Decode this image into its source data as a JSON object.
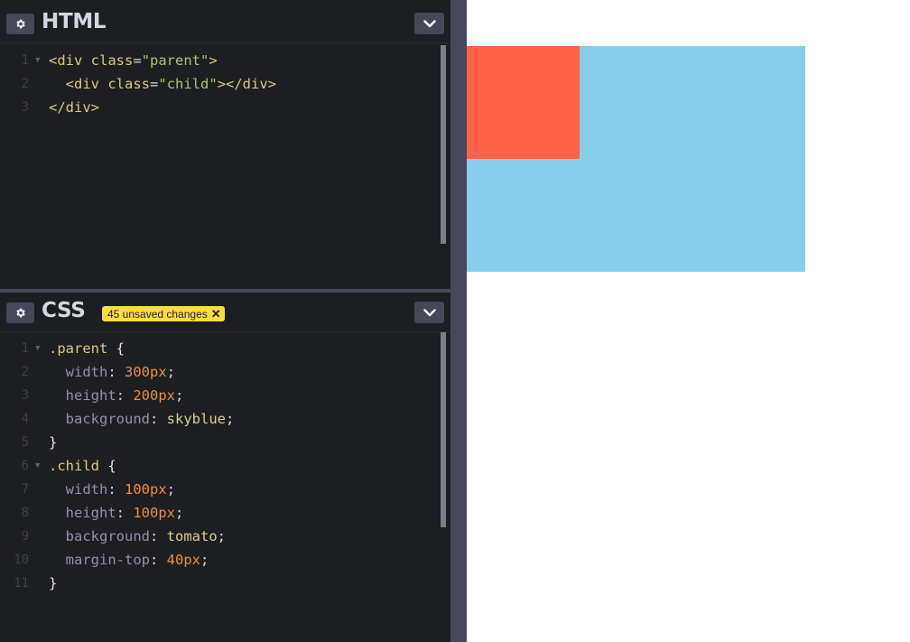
{
  "html_panel": {
    "title": "HTML",
    "lines": [
      {
        "n": "1",
        "fold": true,
        "tokens": [
          [
            "tag",
            "<div "
          ],
          [
            "attr",
            "class"
          ],
          [
            "punct",
            "="
          ],
          [
            "str",
            "\"parent\""
          ],
          [
            "tag",
            ">"
          ]
        ]
      },
      {
        "n": "2",
        "fold": false,
        "tokens": [
          [
            "plain",
            "  "
          ],
          [
            "tag",
            "<div "
          ],
          [
            "attr",
            "class"
          ],
          [
            "punct",
            "="
          ],
          [
            "str",
            "\"child\""
          ],
          [
            "tag",
            "></div>"
          ]
        ]
      },
      {
        "n": "3",
        "fold": false,
        "tokens": [
          [
            "tag",
            "</div>"
          ]
        ]
      }
    ]
  },
  "css_panel": {
    "title": "CSS",
    "badge": "45 unsaved changes",
    "lines": [
      {
        "n": "1",
        "fold": true,
        "tokens": [
          [
            "sel",
            ".parent"
          ],
          [
            "plain",
            " "
          ],
          [
            "brace",
            "{"
          ]
        ]
      },
      {
        "n": "2",
        "fold": false,
        "tokens": [
          [
            "plain",
            "  "
          ],
          [
            "prop",
            "width"
          ],
          [
            "punct",
            ": "
          ],
          [
            "num",
            "300px"
          ],
          [
            "punct",
            ";"
          ]
        ]
      },
      {
        "n": "3",
        "fold": false,
        "tokens": [
          [
            "plain",
            "  "
          ],
          [
            "prop",
            "height"
          ],
          [
            "punct",
            ": "
          ],
          [
            "num",
            "200px"
          ],
          [
            "punct",
            ";"
          ]
        ]
      },
      {
        "n": "4",
        "fold": false,
        "tokens": [
          [
            "plain",
            "  "
          ],
          [
            "prop",
            "background"
          ],
          [
            "punct",
            ": "
          ],
          [
            "kw",
            "skyblue"
          ],
          [
            "punct",
            ";"
          ]
        ]
      },
      {
        "n": "5",
        "fold": false,
        "tokens": [
          [
            "brace",
            "}"
          ]
        ]
      },
      {
        "n": "6",
        "fold": true,
        "tokens": [
          [
            "sel",
            ".child"
          ],
          [
            "plain",
            " "
          ],
          [
            "brace",
            "{"
          ]
        ]
      },
      {
        "n": "7",
        "fold": false,
        "tokens": [
          [
            "plain",
            "  "
          ],
          [
            "prop",
            "width"
          ],
          [
            "punct",
            ": "
          ],
          [
            "num",
            "100px"
          ],
          [
            "punct",
            ";"
          ]
        ]
      },
      {
        "n": "8",
        "fold": false,
        "tokens": [
          [
            "plain",
            "  "
          ],
          [
            "prop",
            "height"
          ],
          [
            "punct",
            ": "
          ],
          [
            "num",
            "100px"
          ],
          [
            "punct",
            ";"
          ]
        ]
      },
      {
        "n": "9",
        "fold": false,
        "tokens": [
          [
            "plain",
            "  "
          ],
          [
            "prop",
            "background"
          ],
          [
            "punct",
            ": "
          ],
          [
            "kw",
            "tomato"
          ],
          [
            "punct",
            ";"
          ]
        ]
      },
      {
        "n": "10",
        "fold": false,
        "tokens": [
          [
            "plain",
            "  "
          ],
          [
            "prop",
            "margin-top"
          ],
          [
            "punct",
            ": "
          ],
          [
            "num",
            "40px"
          ],
          [
            "punct",
            ";"
          ]
        ]
      },
      {
        "n": "11",
        "fold": false,
        "tokens": [
          [
            "brace",
            "}"
          ]
        ]
      }
    ]
  },
  "icons": {
    "settings": "gear-icon",
    "collapse": "chevron-down-icon",
    "badge_close": "close-icon"
  },
  "preview": {
    "parent_color": "#87ceeb",
    "child_color": "#ff6347"
  }
}
